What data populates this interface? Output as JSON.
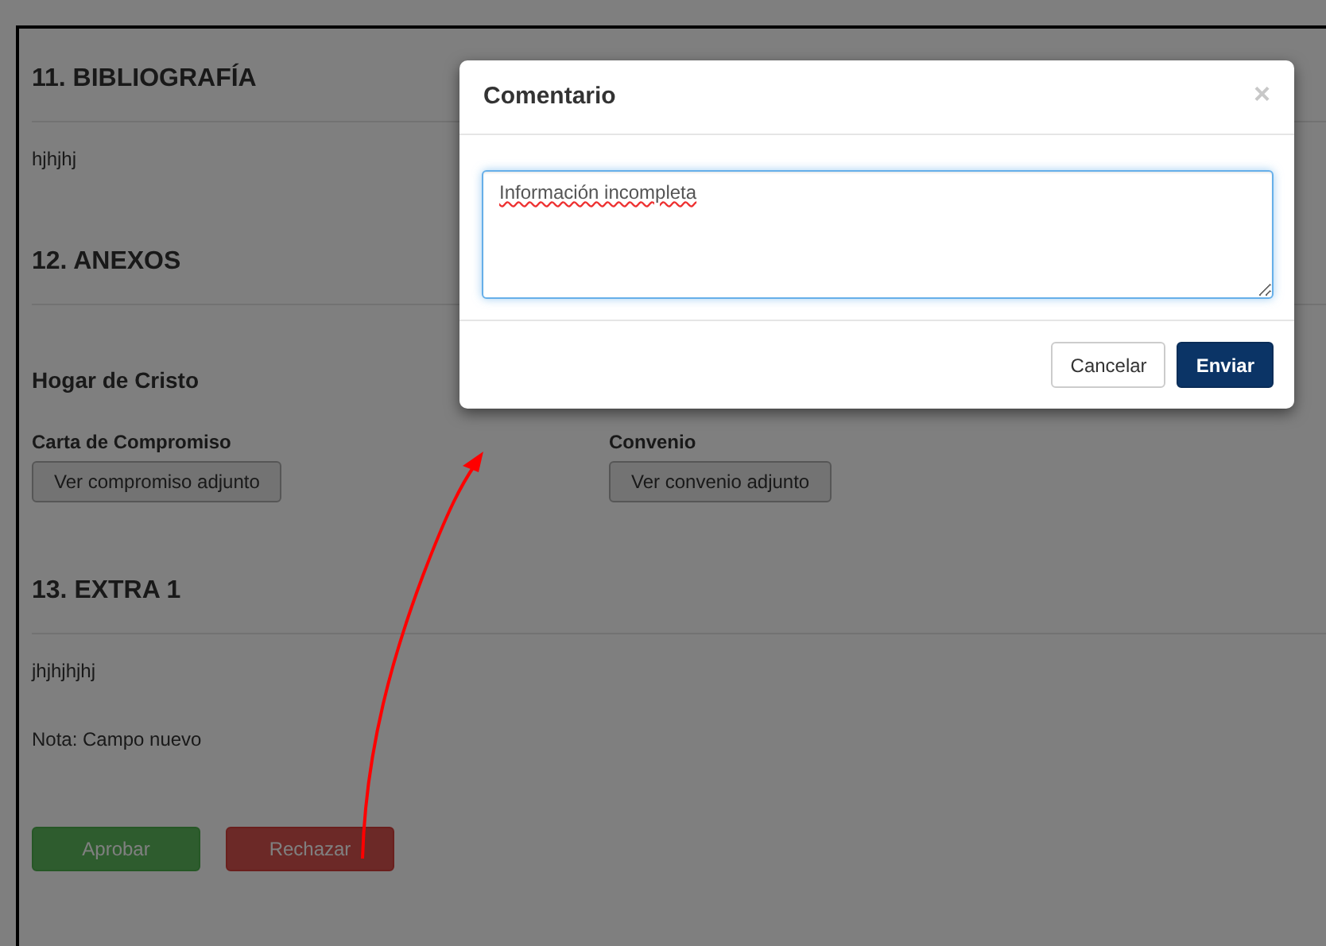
{
  "sections": [
    {
      "title": "11. BIBLIOGRAFÍA",
      "items": [
        {
          "kind": "text",
          "text": "hjhjhj"
        }
      ]
    },
    {
      "title": "12. ANEXOS",
      "items": [
        {
          "kind": "subheading",
          "text": "Hogar de Cristo"
        },
        {
          "kind": "attachments",
          "fields": [
            {
              "label": "Carta de Compromiso",
              "button": "Ver compromiso adjunto"
            },
            {
              "label": "Convenio",
              "button": "Ver convenio adjunto"
            }
          ]
        }
      ]
    },
    {
      "title": "13. EXTRA 1",
      "items": [
        {
          "kind": "text",
          "text": "jhjhjhjhj"
        },
        {
          "kind": "note",
          "text": "Nota: Campo nuevo"
        }
      ]
    }
  ],
  "actions": [
    {
      "label": "Aprobar",
      "kind": "approve"
    },
    {
      "label": "Rechazar",
      "kind": "reject"
    }
  ],
  "dialog": {
    "title": "Comentario",
    "close": "×",
    "comment": {
      "value": "Información incompleta"
    },
    "buttons": [
      {
        "label": "Cancelar",
        "kind": "secondary"
      },
      {
        "label": "Enviar",
        "kind": "primary"
      }
    ]
  }
}
